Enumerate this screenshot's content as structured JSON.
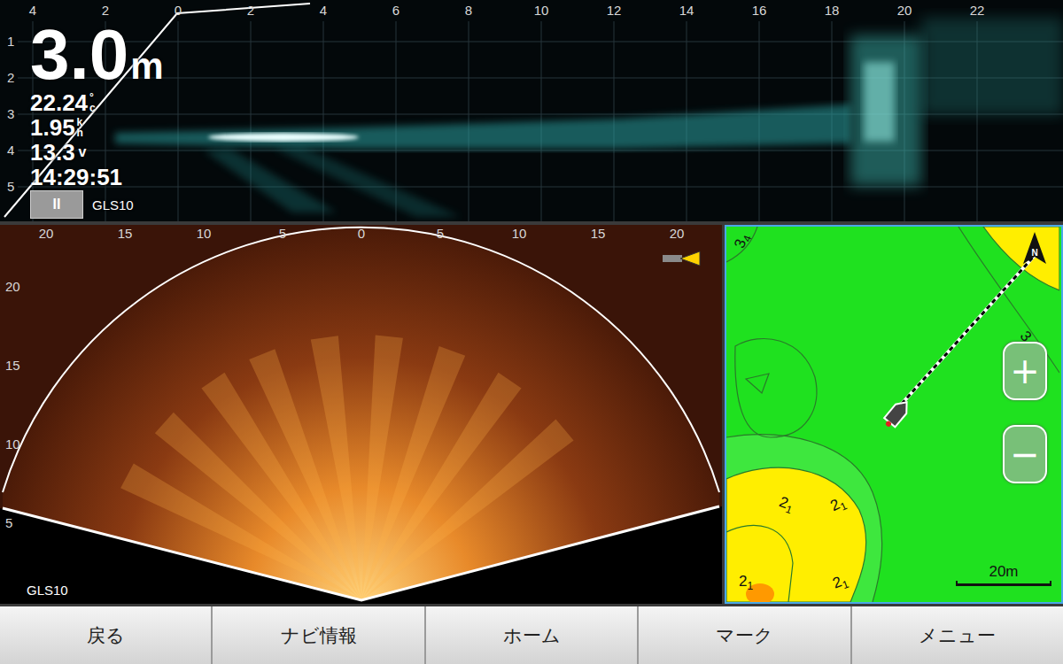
{
  "history_panel": {
    "depth": {
      "value": "3.0",
      "unit": "m"
    },
    "temperature": {
      "value": "22.24",
      "unit_top": "°",
      "unit_bottom": "c"
    },
    "speed": {
      "value": "1.95",
      "unit_top": "k",
      "unit_bottom": "h"
    },
    "voltage": {
      "value": "13.3",
      "unit": "v"
    },
    "time": "14:29:51",
    "source": "GLS10",
    "pause_button": {
      "label": "II"
    },
    "x_axis": [
      "4",
      "2",
      "0",
      "2",
      "4",
      "6",
      "8",
      "10",
      "12",
      "14",
      "16",
      "18",
      "20",
      "22"
    ],
    "y_axis": [
      "1",
      "2",
      "3",
      "4",
      "5"
    ]
  },
  "sonar_panel": {
    "source": "GLS10",
    "x_axis": [
      "20",
      "15",
      "10",
      "5",
      "0",
      "5",
      "10",
      "15",
      "20"
    ],
    "y_axis": [
      "20",
      "15",
      "10",
      "5"
    ]
  },
  "map_panel": {
    "contour_labels": [
      {
        "whole": "3",
        "fraction": "4"
      },
      {
        "whole": "3",
        "fraction": "4"
      },
      {
        "whole": "2",
        "fraction": "1"
      },
      {
        "whole": "2",
        "fraction": "1"
      },
      {
        "whole": "2",
        "fraction": "1"
      },
      {
        "whole": "2",
        "fraction": "1"
      }
    ],
    "north": "N",
    "zoom_in": "+",
    "zoom_out": "−",
    "scale": "20m"
  },
  "buttons": [
    {
      "label": "戻る"
    },
    {
      "label": "ナビ情報"
    },
    {
      "label": "ホーム"
    },
    {
      "label": "マーク"
    },
    {
      "label": "メニュー"
    }
  ]
}
